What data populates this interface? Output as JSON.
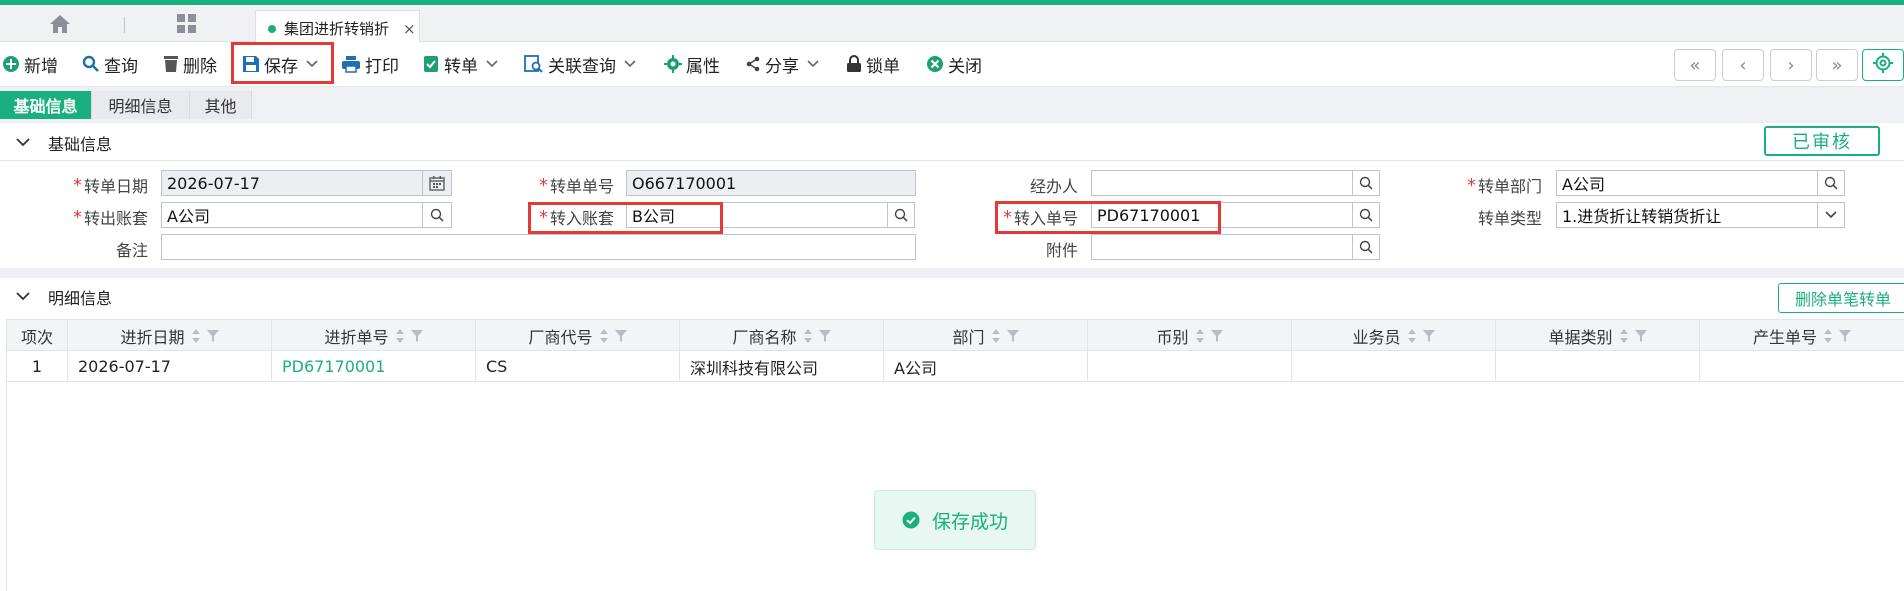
{
  "tabs": {
    "active_label": "集团进折转销折",
    "close_glyph": "×"
  },
  "toolbar": {
    "add": "新增",
    "query": "查询",
    "delete": "删除",
    "save": "保存",
    "print": "打印",
    "transfer": "转单",
    "related_query": "关联查询",
    "properties": "属性",
    "share": "分享",
    "lock": "锁单",
    "close": "关闭"
  },
  "nav": {
    "first": "«",
    "prev": "‹",
    "next": "›",
    "last": "»"
  },
  "subtabs": [
    "基础信息",
    "明细信息",
    "其他"
  ],
  "basic_section": {
    "title": "基础信息",
    "status": "已审核",
    "fields": {
      "transfer_date": {
        "label": "转单日期",
        "value": "2026-07-17"
      },
      "transfer_no": {
        "label": "转单单号",
        "value": "O667170001"
      },
      "handler": {
        "label": "经办人",
        "value": ""
      },
      "transfer_dept": {
        "label": "转单部门",
        "value": "A公司"
      },
      "out_account": {
        "label": "转出账套",
        "value": "A公司"
      },
      "in_account": {
        "label": "转入账套",
        "value": "B公司"
      },
      "in_order_no": {
        "label": "转入单号",
        "value": "PD67170001"
      },
      "transfer_type": {
        "label": "转单类型",
        "value": "1.进货折让转销货折让"
      },
      "remark": {
        "label": "备注",
        "value": ""
      },
      "attachment": {
        "label": "附件",
        "value": ""
      }
    }
  },
  "detail_section": {
    "title": "明细信息",
    "delete_button": "删除单笔转单",
    "columns": [
      "项次",
      "进折日期",
      "进折单号",
      "厂商代号",
      "厂商名称",
      "部门",
      "币别",
      "业务员",
      "单据类别",
      "产生单号"
    ],
    "rows": [
      [
        "1",
        "2026-07-17",
        "PD67170001",
        "CS",
        "深圳科技有限公司",
        "A公司",
        "",
        "",
        "",
        ""
      ]
    ]
  },
  "toast": {
    "message": "保存成功"
  },
  "colors": {
    "accent": "#1aaf7e",
    "highlight": "#e53935",
    "required": "#e53935"
  }
}
